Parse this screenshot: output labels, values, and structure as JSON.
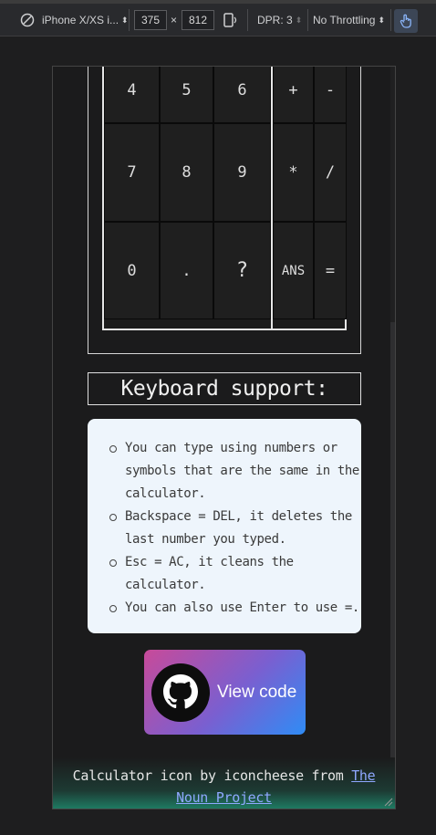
{
  "devtools": {
    "device": "iPhone X/XS i...",
    "width": "375",
    "times": "×",
    "height": "812",
    "dpr": "DPR: 3",
    "throttling": "No Throttling"
  },
  "calculator": {
    "keys": [
      "4",
      "5",
      "6",
      "+",
      "-",
      "7",
      "8",
      "9",
      "*",
      "/",
      "0",
      ".",
      "?",
      "ANS",
      "="
    ]
  },
  "keyboard": {
    "title": "Keyboard support:",
    "tips": [
      "You can type using numbers or symbols that are the same in the calculator.",
      "Backspace = DEL, it deletes the last number you typed.",
      "Esc = AC, it cleans the calculator.",
      "You can also use Enter to use =."
    ]
  },
  "view_code": {
    "label": "View code",
    "icon": "github-icon"
  },
  "footer": {
    "prefix": "Calculator icon by iconcheese from ",
    "link": "The Noun Project"
  },
  "colors": {
    "tips_bg": "#eef5fc",
    "gradient_start": "#c84a99",
    "gradient_end": "#2f8cf5",
    "link": "#8fa8ff"
  }
}
